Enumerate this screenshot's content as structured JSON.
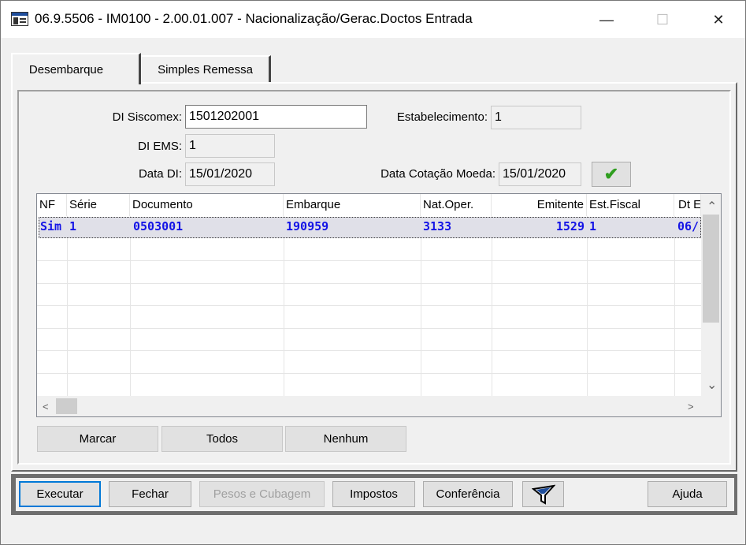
{
  "window": {
    "title": "06.9.5506 - IM0100 - 2.00.01.007 - Nacionalização/Gerac.Doctos Entrada",
    "minimize": "—",
    "maximize": "☐",
    "close": "✕"
  },
  "tabs": [
    {
      "label": "Desembarque",
      "active": true
    },
    {
      "label": "Simples Remessa",
      "active": false
    }
  ],
  "form": {
    "di_siscomex_label": "DI Siscomex:",
    "di_siscomex_value": "1501202001",
    "estabelecimento_label": "Estabelecimento:",
    "estabelecimento_value": "1",
    "di_ems_label": "DI EMS:",
    "di_ems_value": "1",
    "data_di_label": "Data DI:",
    "data_di_value": "15/01/2020",
    "data_cotacao_label": "Data Cotação Moeda:",
    "data_cotacao_value": "15/01/2020",
    "confirm_icon": "check-icon"
  },
  "grid": {
    "columns": [
      "NF",
      "Série",
      "Documento",
      "Embarque",
      "Nat.Oper.",
      "Emitente",
      "Est.Fiscal",
      "Dt E"
    ],
    "rows": [
      [
        "Sim",
        "1",
        "0503001",
        "190959",
        "3133",
        "1529",
        "1",
        "06/"
      ]
    ],
    "scroll_up": "⌃",
    "scroll_down": "⌄",
    "scroll_left": "<",
    "scroll_right": ">"
  },
  "grid_buttons": {
    "marcar": "Marcar",
    "todos": "Todos",
    "nenhum": "Nenhum"
  },
  "footer": {
    "executar": "Executar",
    "fechar": "Fechar",
    "pesos": "Pesos e Cubagem",
    "impostos": "Impostos",
    "conferencia": "Conferência",
    "filter_icon": "funnel-icon",
    "ajuda": "Ajuda"
  },
  "colors": {
    "grid_text": "#1414e6",
    "check": "#2f9e1f",
    "focus": "#0078d7"
  }
}
